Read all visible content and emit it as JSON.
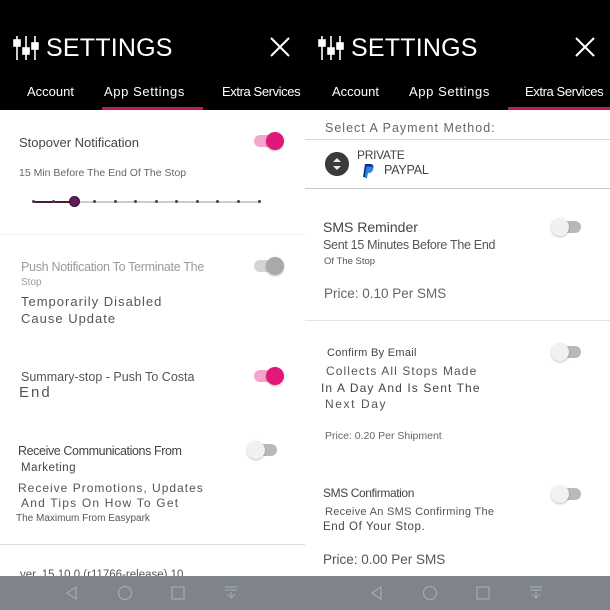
{
  "colors": {
    "accent": "#e0187a",
    "tab_underline": "#c2185b",
    "header_bg": "#000000",
    "navbar_bg": "#7f848c",
    "slider_active": "#4a1942"
  },
  "left": {
    "header": {
      "title": "SETTINGS",
      "icon": "sliders-icon",
      "close_icon": "close-icon"
    },
    "tabs": [
      {
        "label": "Account",
        "active": false
      },
      {
        "label": "App Settings",
        "active": true
      },
      {
        "label": "Extra Services",
        "active": false
      }
    ],
    "stopover": {
      "title": "Stopover Notification",
      "enabled": true,
      "subtitle": "15 Min Before The End Of The Stop",
      "slider": {
        "stops": 12,
        "selected_index": 2
      }
    },
    "push_terminate": {
      "title_line1": "Push Notification To Terminate The",
      "title_line2": "Stop",
      "enabled": true,
      "disabled": true,
      "note_line1": "Temporarily Disabled",
      "note_line2": "Cause Update"
    },
    "summary_stop": {
      "title_line1": "Summary-stop - Push To Costa",
      "title_line2": "End",
      "enabled": true
    },
    "marketing": {
      "title_line1": "Receive Communications From",
      "title_line2": "Marketing",
      "enabled": false,
      "desc_line1": "Receive Promotions, Updates",
      "desc_line2": "And Tips On How To Get",
      "desc_line3": "The Maximum From Easypark"
    },
    "version": "ver. 15.10.0 (r11766-release) 10"
  },
  "right": {
    "header": {
      "title": "SETTINGS",
      "icon": "sliders-icon",
      "close_icon": "close-icon"
    },
    "tabs": [
      {
        "label": "Account",
        "active": false
      },
      {
        "label": "App Settings",
        "active": false
      },
      {
        "label": "Extra Services",
        "active": true
      }
    ],
    "payment": {
      "label": "Select A Payment Method:",
      "account_type": "PRIVATE",
      "method": "PAYPAL",
      "selector_icon": "up-down-icon",
      "method_icon": "paypal-icon"
    },
    "sms_reminder": {
      "title": "SMS Reminder",
      "desc_line1": "Sent 15 Minutes Before The End",
      "desc_line2": "Of The Stop",
      "price": "Price: 0.10 Per SMS",
      "enabled": false
    },
    "confirm_email": {
      "title": "Confirm By Email",
      "desc_line1": "Collects All Stops Made",
      "desc_line2": "In A Day And Is Sent The",
      "desc_line3": "Next Day",
      "price": "Price: 0.20 Per Shipment",
      "enabled": false
    },
    "sms_confirmation": {
      "title": "SMS Confirmation",
      "desc_line1": "Receive An SMS Confirming The",
      "desc_line2": "End Of Your Stop.",
      "price": "Price: 0.00 Per SMS",
      "enabled": false
    }
  },
  "navbar": {
    "buttons": [
      "back-icon",
      "home-icon",
      "recents-icon",
      "notification-pull-icon"
    ]
  }
}
